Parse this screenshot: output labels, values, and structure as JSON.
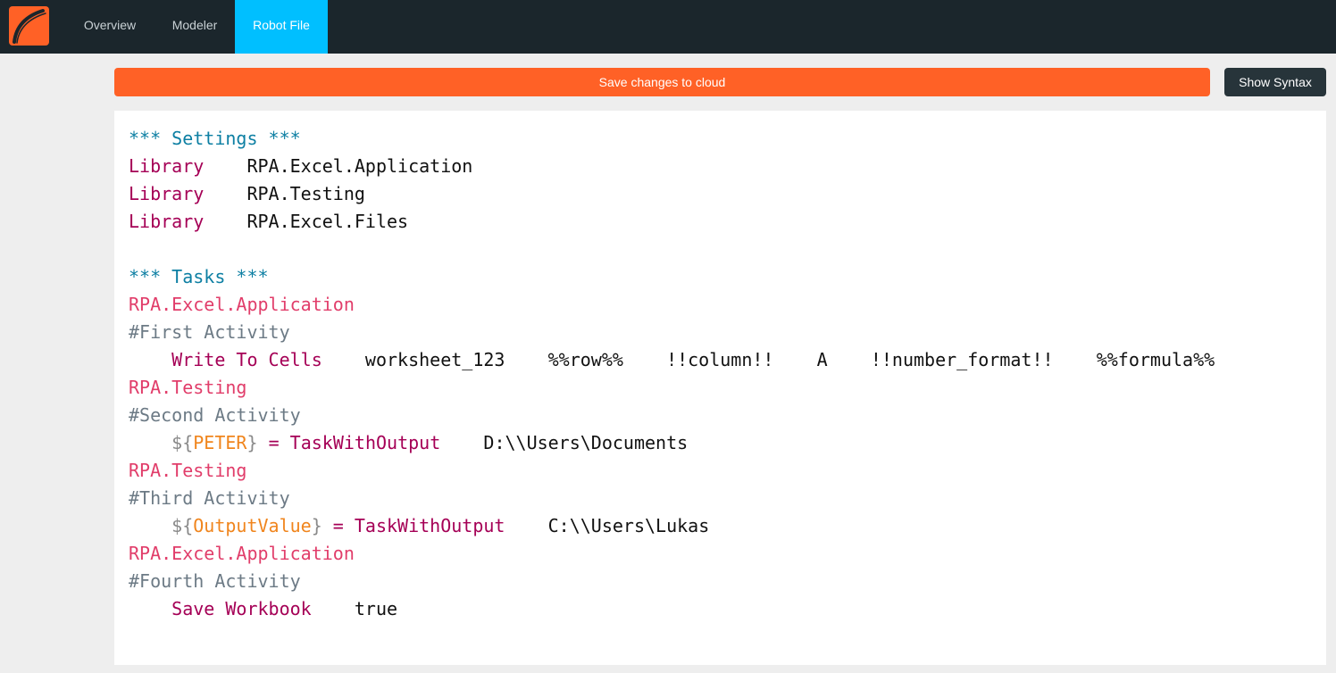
{
  "nav": {
    "logo_icon": "robot-framework-logo-icon",
    "tabs": [
      {
        "label": "Overview",
        "active": false
      },
      {
        "label": "Modeler",
        "active": false
      },
      {
        "label": "Robot File",
        "active": true
      }
    ]
  },
  "toolbar": {
    "save_label": "Save changes to cloud",
    "syntax_label": "Show Syntax"
  },
  "colors": {
    "topbar": "#1b262c",
    "active_tab": "#00bfff",
    "save_button": "#ff6126",
    "syntax_button": "#27343a",
    "section_header": "#0d7fa3",
    "keyword": "#a50056",
    "task_name": "#e13d6a",
    "comment": "#6c7a85",
    "variable": "#f0851d"
  },
  "editor": {
    "lines": [
      [
        {
          "t": "*** Settings ***",
          "c": "section"
        }
      ],
      [
        {
          "t": "Library",
          "c": "keyword"
        },
        {
          "t": "    RPA.Excel.Application",
          "c": "plain"
        }
      ],
      [
        {
          "t": "Library",
          "c": "keyword"
        },
        {
          "t": "    RPA.Testing",
          "c": "plain"
        }
      ],
      [
        {
          "t": "Library",
          "c": "keyword"
        },
        {
          "t": "    RPA.Excel.Files",
          "c": "plain"
        }
      ],
      [],
      [
        {
          "t": "*** Tasks ***",
          "c": "section"
        }
      ],
      [
        {
          "t": "RPA.Excel.Application",
          "c": "task"
        }
      ],
      [
        {
          "t": "#First Activity",
          "c": "comment"
        }
      ],
      [
        {
          "t": "    ",
          "c": "plain"
        },
        {
          "t": "Write To Cells",
          "c": "keyword"
        },
        {
          "t": "    worksheet_123    %%row%%    !!column!!    A    !!number_format!!    %%formula%%",
          "c": "plain"
        }
      ],
      [
        {
          "t": "RPA.Testing",
          "c": "task"
        }
      ],
      [
        {
          "t": "#Second Activity",
          "c": "comment"
        }
      ],
      [
        {
          "t": "    ",
          "c": "plain"
        },
        {
          "t": "${",
          "c": "var-delim"
        },
        {
          "t": "PETER",
          "c": "var-name"
        },
        {
          "t": "}",
          "c": "var-delim"
        },
        {
          "t": " = TaskWithOutput",
          "c": "keyword"
        },
        {
          "t": "    D:\\\\Users\\Documents",
          "c": "plain"
        }
      ],
      [
        {
          "t": "RPA.Testing",
          "c": "task"
        }
      ],
      [
        {
          "t": "#Third Activity",
          "c": "comment"
        }
      ],
      [
        {
          "t": "    ",
          "c": "plain"
        },
        {
          "t": "${",
          "c": "var-delim"
        },
        {
          "t": "OutputValue",
          "c": "var-name"
        },
        {
          "t": "}",
          "c": "var-delim"
        },
        {
          "t": " = TaskWithOutput",
          "c": "keyword"
        },
        {
          "t": "    C:\\\\Users\\Lukas",
          "c": "plain"
        }
      ],
      [
        {
          "t": "RPA.Excel.Application",
          "c": "task"
        }
      ],
      [
        {
          "t": "#Fourth Activity",
          "c": "comment"
        }
      ],
      [
        {
          "t": "    ",
          "c": "plain"
        },
        {
          "t": "Save Workbook",
          "c": "keyword"
        },
        {
          "t": "    true",
          "c": "plain"
        }
      ]
    ]
  }
}
